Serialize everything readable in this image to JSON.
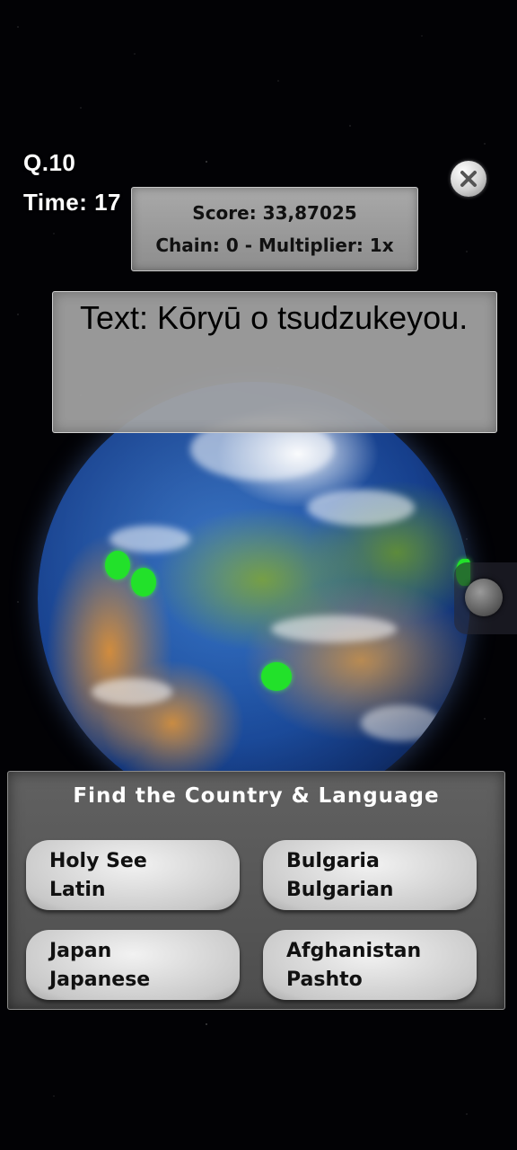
{
  "hud": {
    "question": "Q.10",
    "time": "Time: 17"
  },
  "score_panel": {
    "score": "Score: 33,87025",
    "chain": "Chain: 0 - Multiplier: 1x"
  },
  "prompt": {
    "text": "Text: Kōryū o tsudzukeyou."
  },
  "answers": {
    "title": "Find the Country & Language",
    "options": [
      {
        "country": "Holy See",
        "language": "Latin"
      },
      {
        "country": "Bulgaria",
        "language": "Bulgarian"
      },
      {
        "country": "Japan",
        "language": "Japanese"
      },
      {
        "country": "Afghanistan",
        "language": "Pashto"
      }
    ]
  },
  "colors": {
    "marker": "#22e12a",
    "panel_gray": "#a9a9a9",
    "answer_panel": "#555555"
  },
  "icons": {
    "close": "close-icon",
    "handle": "rotate-knob-icon"
  }
}
